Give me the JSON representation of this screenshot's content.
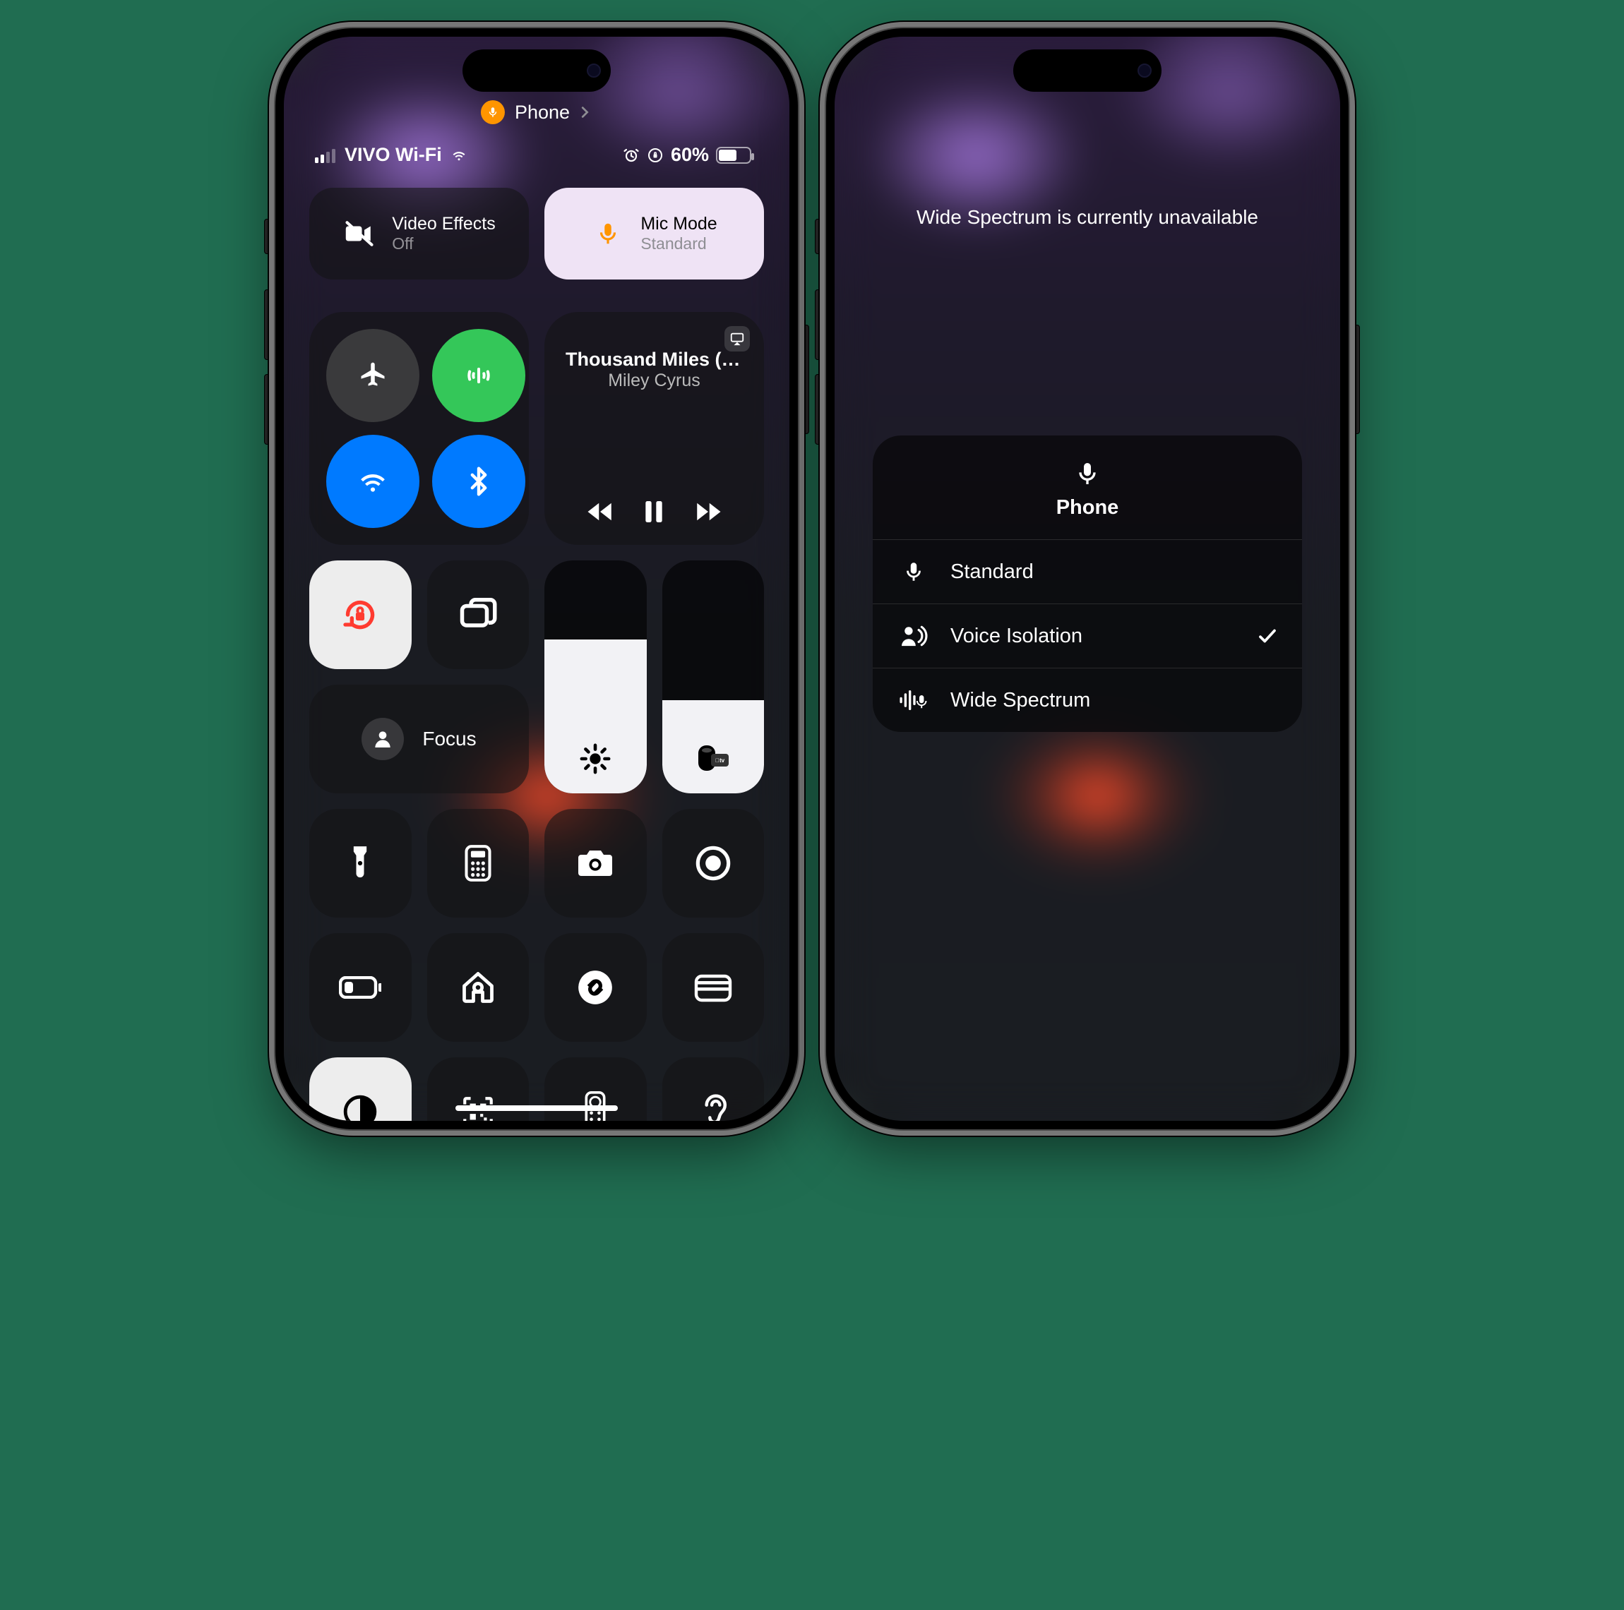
{
  "breadcrumb": {
    "app": "Phone"
  },
  "status": {
    "carrier": "VIVO Wi-Fi",
    "battery_pct": "60%"
  },
  "video_effects": {
    "label": "Video Effects",
    "state": "Off"
  },
  "mic_mode": {
    "label": "Mic Mode",
    "state": "Standard"
  },
  "now_playing": {
    "title": "Thousand Miles (…",
    "artist": "Miley Cyrus"
  },
  "focus": {
    "label": "Focus"
  },
  "mic_panel": {
    "message": "Wide Spectrum is currently unavailable",
    "app": "Phone",
    "options": {
      "standard": "Standard",
      "isolation": "Voice Isolation",
      "wide": "Wide Spectrum"
    },
    "selected": "isolation"
  }
}
